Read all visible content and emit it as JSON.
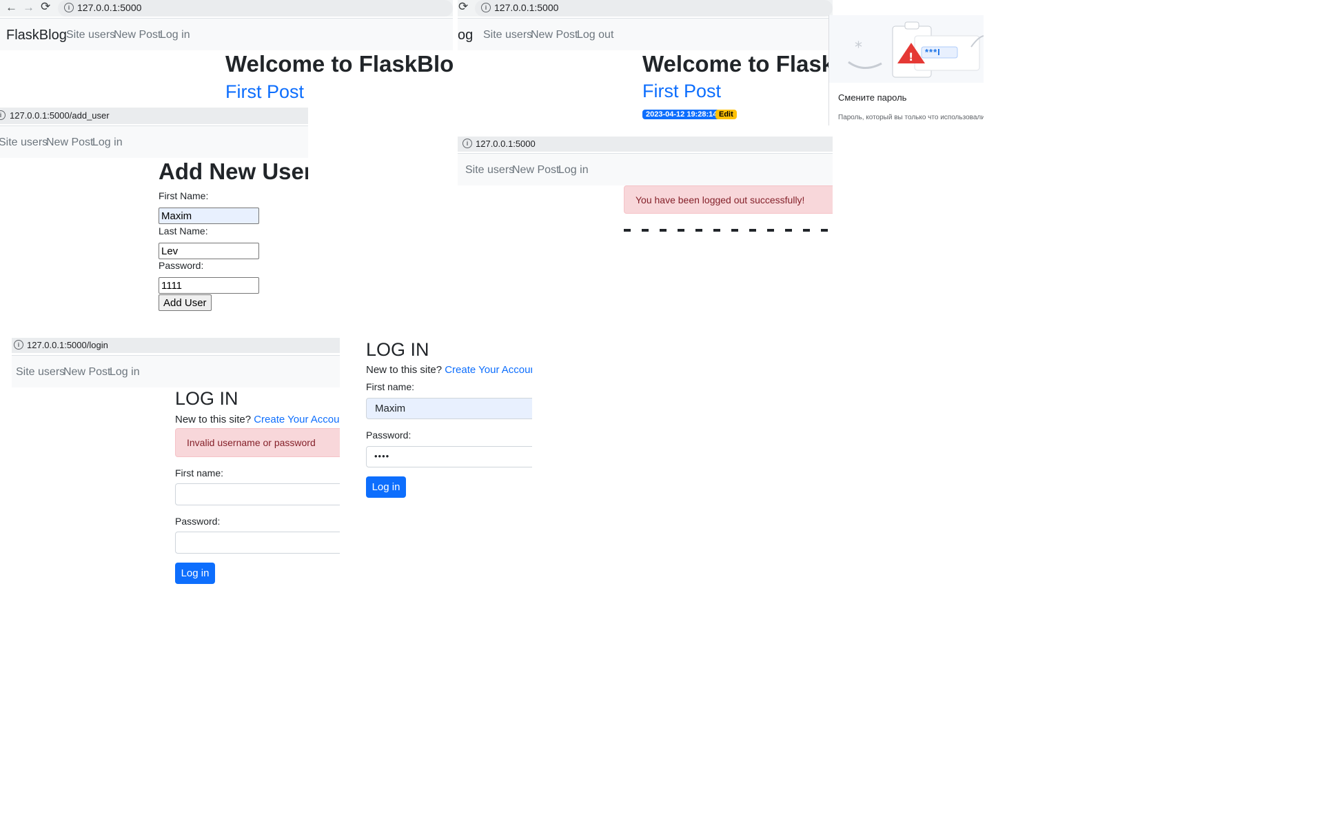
{
  "panel1": {
    "url": "127.0.0.1:5000",
    "brand": "FlaskBlog",
    "nav": [
      "Site users",
      "New Post",
      "Log in"
    ],
    "heading": "Welcome to FlaskBlog",
    "post_title": "First Post"
  },
  "panel2": {
    "url": "127.0.0.1:5000",
    "brand_fragment": "og",
    "nav": [
      "Site users",
      "New Post",
      "Log out"
    ],
    "heading": "Welcome to FlaskB",
    "post_title": "First Post",
    "timestamp_badge": "2023-04-12 19:28:14",
    "edit_badge": "Edit",
    "popup": {
      "title": "Смените пароль",
      "text": "Пароль, который вы только что использовали,",
      "password_mask": "***I"
    }
  },
  "panel3": {
    "url": "127.0.0.1:5000/add_user",
    "nav": [
      "Site users",
      "New Post",
      "Log in"
    ],
    "heading": "Add New User",
    "first_name_label": "First Name:",
    "first_name_value": "Maxim",
    "last_name_label": "Last Name:",
    "last_name_value": "Lev",
    "password_label": "Password:",
    "password_value": "1111",
    "submit_label": "Add User"
  },
  "panel4": {
    "url": "127.0.0.1:5000",
    "nav": [
      "Site users",
      "New Post",
      "Log in"
    ],
    "alert": "You have been logged out successfully!"
  },
  "panel5": {
    "url": "127.0.0.1:5000/login",
    "nav": [
      "Site users",
      "New Post",
      "Log in"
    ],
    "heading": "LOG IN",
    "new_text": "New to this site?",
    "create_link": "Create Your Account",
    "alert": "Invalid username or password",
    "first_name_label": "First name:",
    "password_label": "Password:",
    "submit_label": "Log in"
  },
  "panel6": {
    "heading": "LOG IN",
    "new_text": "New to this site?",
    "create_link": "Create Your Account",
    "first_name_label": "First name:",
    "first_name_value": "Maxim",
    "password_label": "Password:",
    "password_value": "••••",
    "submit_label": "Log in"
  },
  "colors": {
    "primary": "#0d6efd",
    "alert_bg": "#f8d7da",
    "badge_warning": "#ffc107",
    "danger_icon": "#e53935"
  }
}
